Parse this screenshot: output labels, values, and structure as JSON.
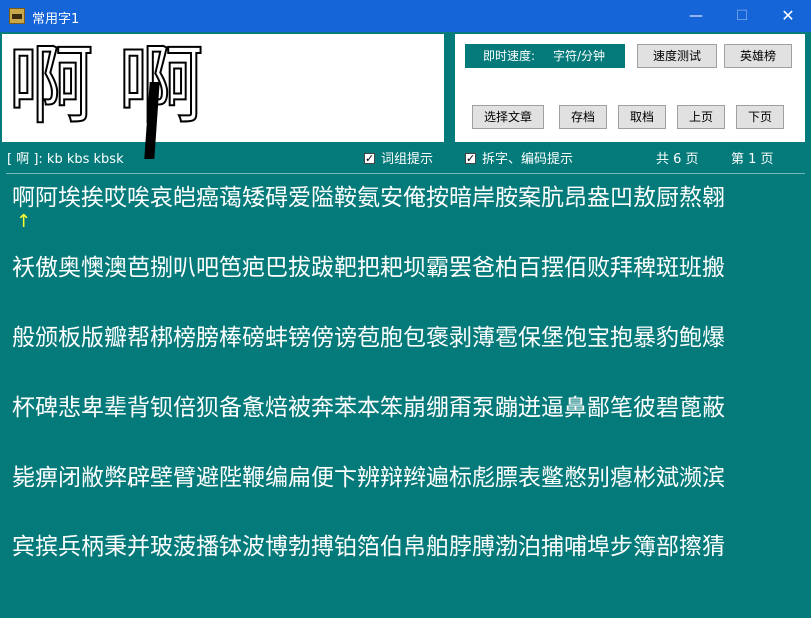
{
  "window": {
    "title": "常用字1",
    "minimize": "—",
    "maximize": "☐",
    "close": "✕"
  },
  "preview": {
    "glyph_plain": "啊",
    "glyph_styled": "啊"
  },
  "controls": {
    "speed_label": "即时速度:",
    "speed_unit": "字符/分钟",
    "speed_test_button": "速度测试",
    "heroes_button": "英雄榜",
    "choose_article_button": "选择文章",
    "save_button": "存档",
    "load_button": "取档",
    "prev_page_button": "上页",
    "next_page_button": "下页"
  },
  "info": {
    "code_hint": "[ 啊 ]:  kb   kbs   kbsk",
    "option_word_hint": "词组提示",
    "option_split_hint": "拆字、编码提示",
    "word_hint_checked": true,
    "split_hint_checked": true,
    "total_pages": "共 6 页",
    "current_page": "第 1 页"
  },
  "text_lines": [
    "啊阿埃挨哎唉哀皑癌蔼矮碍爱隘鞍氨安俺按暗岸胺案肮昂盎凹敖厨熬翱",
    "袄傲奥懊澳芭捌叭吧笆疤巴拔跋靶把耙坝霸罢爸柏百摆佰败拜稗斑班搬",
    "般颁板版瓣帮梆榜膀棒磅蚌镑傍谤苞胞包褒剥薄雹保堡饱宝抱暴豹鲍爆",
    "杯碑悲卑辈背钡倍狈备惫焙被奔苯本笨崩绷甭泵蹦迸逼鼻鄙笔彼碧蓖蔽",
    "毙痹闭敝弊辟壁臂避陛鞭编扁便卞辨辩辫遍标彪膘表鳖憋别瘪彬斌濒滨",
    "宾摈兵柄秉并玻菠播钵波博勃搏铂箔伯帛舶脖膊渤泊捕哺埠步簿部擦猜"
  ],
  "cursor": "↑"
}
